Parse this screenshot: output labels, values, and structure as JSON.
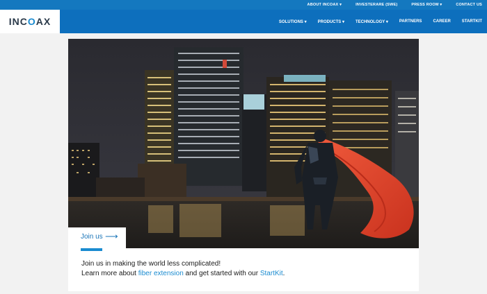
{
  "topbar": {
    "links": [
      "ABOUT INCOAX ▾",
      "INVESTERARE (SWE)",
      "PRESS ROOM ▾",
      "CONTACT US"
    ]
  },
  "header": {
    "logo_left": "INC",
    "logo_o": "O",
    "logo_right": "AX",
    "nav": [
      "SOLUTIONS ▾",
      "PRODUCTS ▾",
      "TECHNOLOGY ▾",
      "PARTNERS",
      "CAREER",
      "STARTKIT"
    ]
  },
  "hero": {
    "join_label": "Join us",
    "join_arrow": "⟶"
  },
  "body": {
    "line1": "Join us in making the world less complicated!",
    "line2_a": "Learn more about ",
    "line2_link1": "fiber extension",
    "line2_b": " and get started with our ",
    "line2_link2": "StartKit",
    "line2_c": "."
  },
  "colors": {
    "topbar": "#1478bf",
    "mainbar": "#0d6fbd",
    "accent": "#1a8bd0",
    "cape": "#e8452c"
  }
}
